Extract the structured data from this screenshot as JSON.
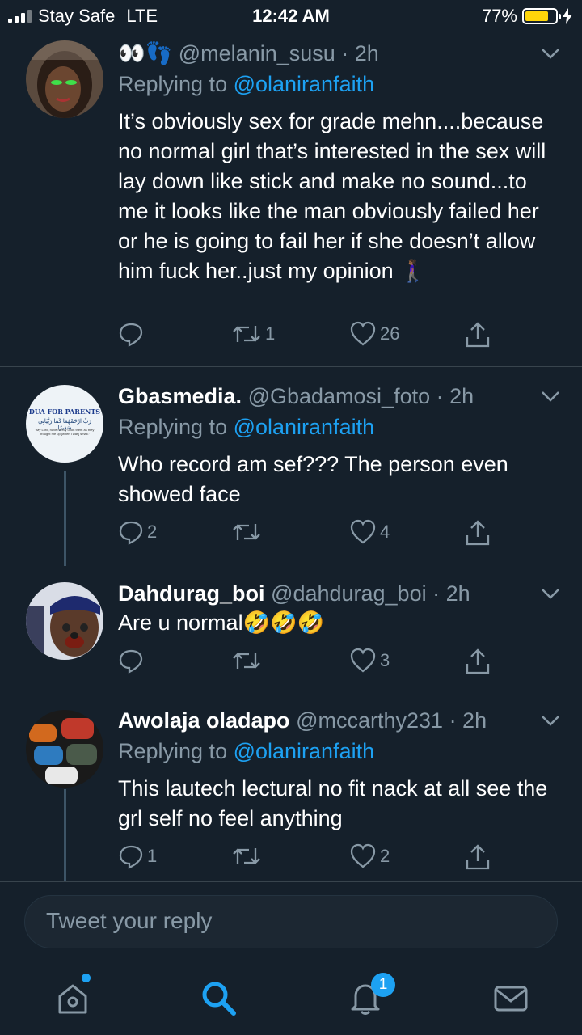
{
  "status_bar": {
    "carrier": "Stay Safe",
    "network": "LTE",
    "time": "12:42 AM",
    "battery": "77%",
    "battery_level": 0.77
  },
  "tweets": [
    {
      "name": "",
      "name_emoji": "👀👣",
      "handle": "@melanin_susu",
      "time": "· 2h",
      "reply_prefix": "Replying to ",
      "reply_to": "@olaniranfaith",
      "text": "It’s obviously sex for grade mehn....because no normal girl that’s interested in the sex will lay down like stick and make no sound...to me it looks like the man obviously failed her or he is going to fail her if she doesn’t allow him fuck her..just my opinion 🚶🏾‍♀️",
      "replies": "",
      "retweets": "1",
      "likes": "26"
    },
    {
      "name": "Gbasmedia.",
      "handle": "@Gbadamosi_foto",
      "time": "· 2h",
      "reply_prefix": "Replying to ",
      "reply_to": "@olaniranfaith",
      "text": "Who record am sef??? The person even showed face",
      "replies": "2",
      "retweets": "",
      "likes": "4",
      "avatar_text": "DUA FOR PARENTS",
      "avatar_arabic": "رَبِّ ارْحَمْهُمَا كَمَا رَبَّيَانِي صَغِيرًا",
      "avatar_caption": "\"My Lord, have mercy upon them as they brought me up [when I was] small.\""
    },
    {
      "name": "Dahdurag_boi",
      "handle": "@dahdurag_boi",
      "time": "· 2h",
      "text": "Are u normal🤣🤣🤣",
      "replies": "",
      "retweets": "",
      "likes": "3"
    },
    {
      "name": "Awolaja oladapo",
      "handle": "@mccarthy231",
      "time": "· 2h",
      "reply_prefix": "Replying to ",
      "reply_to": "@olaniranfaith",
      "text": "This lautech lectural no fit nack at all see the grl self no feel anything",
      "replies": "1",
      "retweets": "",
      "likes": "2"
    }
  ],
  "reply_box": {
    "placeholder": "Tweet your reply"
  },
  "tab_bar": {
    "notification_count": "1"
  },
  "colors": {
    "background": "#15202b",
    "accent": "#1da1f2",
    "muted": "#8899a6",
    "divider": "#38444d"
  }
}
